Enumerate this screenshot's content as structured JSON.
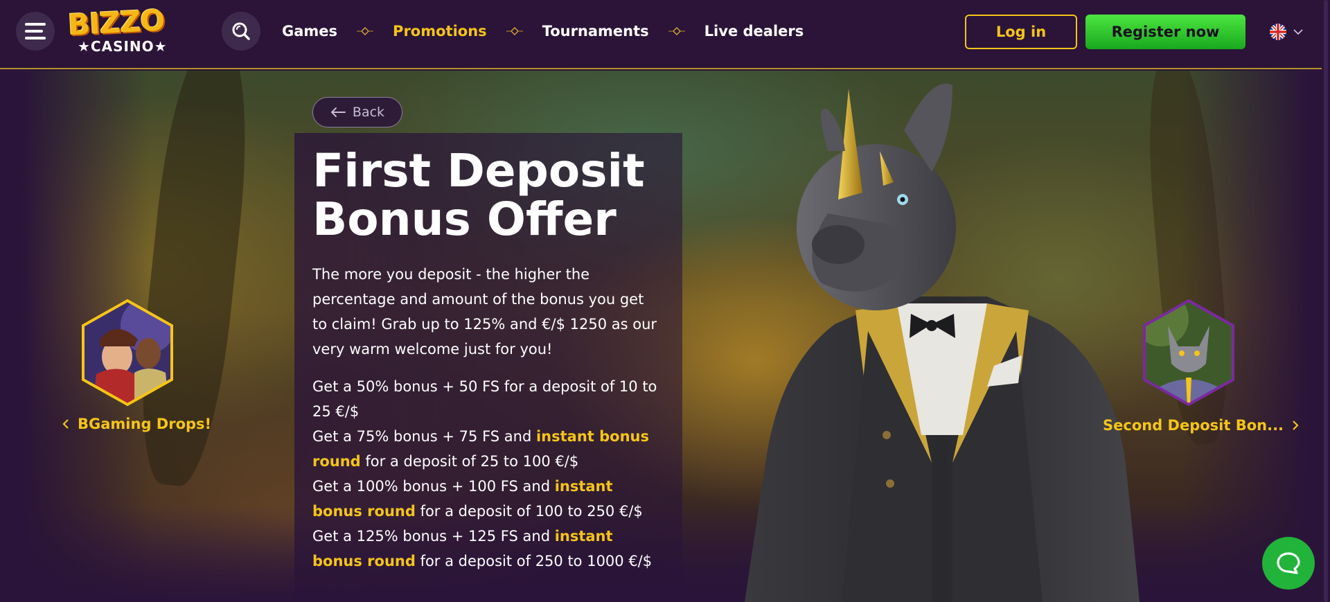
{
  "header": {
    "logo_top": "BIZZO",
    "logo_bottom": "★CASINO★",
    "nav": [
      {
        "label": "Games",
        "active": false
      },
      {
        "label": "Promotions",
        "active": true
      },
      {
        "label": "Tournaments",
        "active": false
      },
      {
        "label": "Live dealers",
        "active": false
      }
    ],
    "login_label": "Log in",
    "register_label": "Register now",
    "language": "en"
  },
  "promo": {
    "back_label": "Back",
    "title_line1": "First Deposit",
    "title_line2": "Bonus Offer",
    "intro": "The more you deposit - the higher the percentage and amount of the bonus you get to claim! Grab up to 125% and €/$ 1250 as our very warm welcome just for you!",
    "offers": [
      {
        "pre": "Get a 50% bonus + 50 FS for a deposit of 10 to 25 €/$",
        "highlight": "",
        "post": ""
      },
      {
        "pre": "Get a 75% bonus + 75 FS and ",
        "highlight": "instant bonus round",
        "post": " for a deposit of 25 to 100 €/$"
      },
      {
        "pre": "Get a 100% bonus + 100 FS and ",
        "highlight": "instant bonus round",
        "post": " for a deposit of 100 to 250 €/$"
      },
      {
        "pre": "Get a 125% bonus + 125 FS and ",
        "highlight": "instant bonus round",
        "post": " for a deposit of 250 to 1000 €/$"
      }
    ]
  },
  "carousel": {
    "prev_label": "BGaming Drops!",
    "next_label": "Second Deposit Bon..."
  },
  "colors": {
    "background": "#2a1439",
    "accent_yellow": "#f5c518",
    "register_green": "#2bc52a",
    "chat_green": "#22b33a"
  },
  "icons": [
    "menu-icon",
    "search-icon",
    "diamond-separator-icon",
    "uk-flag-icon",
    "chevron-down-icon",
    "arrow-left-icon",
    "chevron-left-icon",
    "chevron-right-icon",
    "chat-icon"
  ]
}
